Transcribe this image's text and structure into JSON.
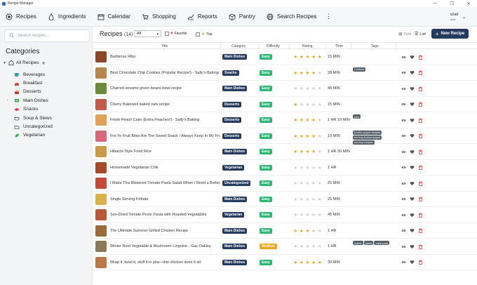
{
  "window": {
    "title": "Recipe Manager",
    "controls": [
      "—",
      "❐",
      "✕"
    ]
  },
  "nav": {
    "items": [
      {
        "label": "Recipes",
        "icon": "target-icon"
      },
      {
        "label": "Ingredients",
        "icon": "drop-icon"
      },
      {
        "label": "Calendar",
        "icon": "calendar-icon"
      },
      {
        "label": "Shopping",
        "icon": "cart-icon"
      },
      {
        "label": "Reports",
        "icon": "chart-icon"
      },
      {
        "label": "Pantry",
        "icon": "box-icon"
      },
      {
        "label": "Search Recipes",
        "icon": "globe-icon"
      }
    ],
    "more": "⋮",
    "user": {
      "name": "user",
      "role": "user"
    }
  },
  "sidebar": {
    "search_placeholder": "Search recipes...",
    "heading": "Categories",
    "all_label": "All Recipes",
    "categories": [
      {
        "label": "Beverages",
        "icon": "cup-icon",
        "expandable": false
      },
      {
        "label": "Breakfast",
        "icon": "car-icon",
        "expandable": false
      },
      {
        "label": "Desserts",
        "icon": "cake-icon",
        "expandable": false
      },
      {
        "label": "Main Dishes",
        "icon": "plate-icon",
        "expandable": true
      },
      {
        "label": "Snacks",
        "icon": "candy-icon",
        "expandable": false
      },
      {
        "label": "Soup & Stews",
        "icon": "pot-icon",
        "expandable": false
      },
      {
        "label": "Uncategorized",
        "icon": "folder-icon",
        "expandable": false
      },
      {
        "label": "Vegetarian",
        "icon": "leaf-icon",
        "expandable": false
      }
    ]
  },
  "toolbar": {
    "title": "Recipes",
    "count": "(14)",
    "filter_value": "All",
    "favorite_label": "Favorite",
    "top_label": "Top",
    "grid_label": "Grid",
    "list_label": "List",
    "new_label": "New Recipe"
  },
  "table": {
    "headers": {
      "title": "Title",
      "category": "Category",
      "difficulty": "Difficulty",
      "rating": "Rating",
      "time": "Time",
      "tags": "Tags"
    },
    "rows": [
      {
        "title": "Barbecue Ribs",
        "category": "Main Dishes",
        "difficulty": "Easy",
        "rating": 5,
        "time": "15 MIN",
        "tags": [],
        "thumb": "#8a4a2a"
      },
      {
        "title": "Best Chocolate Chip Cookies (Popular Recipe!) - Sally's Baking",
        "category": "Snacks",
        "difficulty": "Easy",
        "rating": 4,
        "time": "28 MIN",
        "tags": [
          "Cookies"
        ],
        "thumb": "#b8874f"
      },
      {
        "title": "Charred sesame green beans bowl recipe",
        "category": "Main Dishes",
        "difficulty": "Easy",
        "rating": 0,
        "time": "49 MIN",
        "tags": [],
        "thumb": "#6b8a3a"
      },
      {
        "title": "Cherry Bakewell baked oats recipe",
        "category": "Desserts",
        "difficulty": "Easy",
        "rating": 1,
        "time": "15 MIN",
        "tags": [],
        "thumb": "#c05a4a"
      },
      {
        "title": "Fresh Peach Cake {Extra Peaches!} - Sally's Baking",
        "category": "Desserts",
        "difficulty": "Easy",
        "rating": 4,
        "time": "1 HR 10 MIN",
        "tags": [
          "plus"
        ],
        "thumb": "#e0a25a"
      },
      {
        "title": "Fro-Yo Fruit Bites Are The Sweet Snack I Always Keep In My Freezer",
        "category": "Desserts",
        "difficulty": "Easy",
        "rating": 4,
        "time": "10 MIN",
        "tags": [
          "frozen yogurt recipes",
          "ice tray frozen yogurt",
          "ice tray recipes"
        ],
        "thumb": "#d66a7a"
      },
      {
        "title": "Hibachi-Style Fried Rice",
        "category": "Main Dishes",
        "difficulty": "Easy",
        "rating": 4,
        "time": "1 HR 30 MIN",
        "tags": [],
        "thumb": "#c89a4a"
      },
      {
        "title": "Homemade Vegetarian Chili",
        "category": "Vegetarian",
        "difficulty": "Easy",
        "rating": 0,
        "time": "1 HR",
        "tags": [],
        "thumb": "#a54a2a"
      },
      {
        "title": "I Make This Blistered-Tomato Pasta Salad When I Need a Better Gather",
        "category": "Uncategorized",
        "difficulty": "Easy",
        "rating": 0,
        "time": "25 MIN",
        "tags": [],
        "thumb": "#c44a3a"
      },
      {
        "title": "Single Serving Frittata",
        "category": "Main Dishes",
        "difficulty": "Easy",
        "rating": 0,
        "time": "25 MIN",
        "tags": [],
        "thumb": "#d8b24a"
      },
      {
        "title": "Sun-Dried Tomato Pesto Pasta with Roasted Vegetables",
        "category": "Vegetarian",
        "difficulty": "Easy",
        "rating": 0,
        "time": "45 MIN",
        "tags": [],
        "thumb": "#b85a3a"
      },
      {
        "title": "The Ultimate Summer Grilled Chicken Recipe",
        "category": "Main Dishes",
        "difficulty": "Easy",
        "rating": 3,
        "time": "1 HR",
        "tags": [],
        "thumb": "#9a6a3a"
      },
      {
        "title": "Winter Root Vegetable & Mushroom Linguine - Gaz Oakley",
        "category": "Main Dishes",
        "difficulty": "Medium",
        "rating": 0,
        "time": "1 HR",
        "tags": [
          "mains",
          "pasta",
          "meal prep"
        ],
        "thumb": "#8a7a5a"
      },
      {
        "title": "Wrap it, bowl it, stuff it in pita—this chicken does it all",
        "category": "Main Dishes",
        "difficulty": "Easy",
        "rating": 5,
        "time": "30 MIN",
        "tags": [],
        "thumb": "#b87a4a"
      }
    ]
  },
  "colors": {
    "navy": "#253a5e",
    "easy": "#2bb673",
    "medium": "#f0a51e",
    "star": "#e2a21a",
    "delete": "#d9342b"
  }
}
